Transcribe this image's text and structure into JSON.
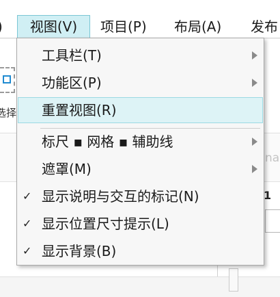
{
  "menubar": {
    "items": [
      {
        "label": ")"
      },
      {
        "label": "视图(V)"
      },
      {
        "label": "项目(P)"
      },
      {
        "label": "布局(A)"
      },
      {
        "label": "发布"
      }
    ]
  },
  "background": {
    "tool_label": "选择",
    "faded_text": "nal",
    "number": "1"
  },
  "view_menu": {
    "items": [
      {
        "label": "工具栏(T)",
        "checked": false,
        "submenu": true
      },
      {
        "label": "功能区(P)",
        "checked": false,
        "submenu": true
      },
      {
        "label": "重置视图(R)",
        "checked": false,
        "submenu": false
      },
      {
        "label": "标尺 ▪ 网格 ▪ 辅助线",
        "checked": false,
        "submenu": true
      },
      {
        "label": "遮罩(M)",
        "checked": false,
        "submenu": true
      },
      {
        "label": "显示说明与交互的标记(N)",
        "checked": true,
        "submenu": false
      },
      {
        "label": "显示位置尺寸提示(L)",
        "checked": true,
        "submenu": false
      },
      {
        "label": "显示背景(B)",
        "checked": true,
        "submenu": false
      }
    ],
    "check_glyph": "✓",
    "highlight_color": "#ddf3f6"
  }
}
